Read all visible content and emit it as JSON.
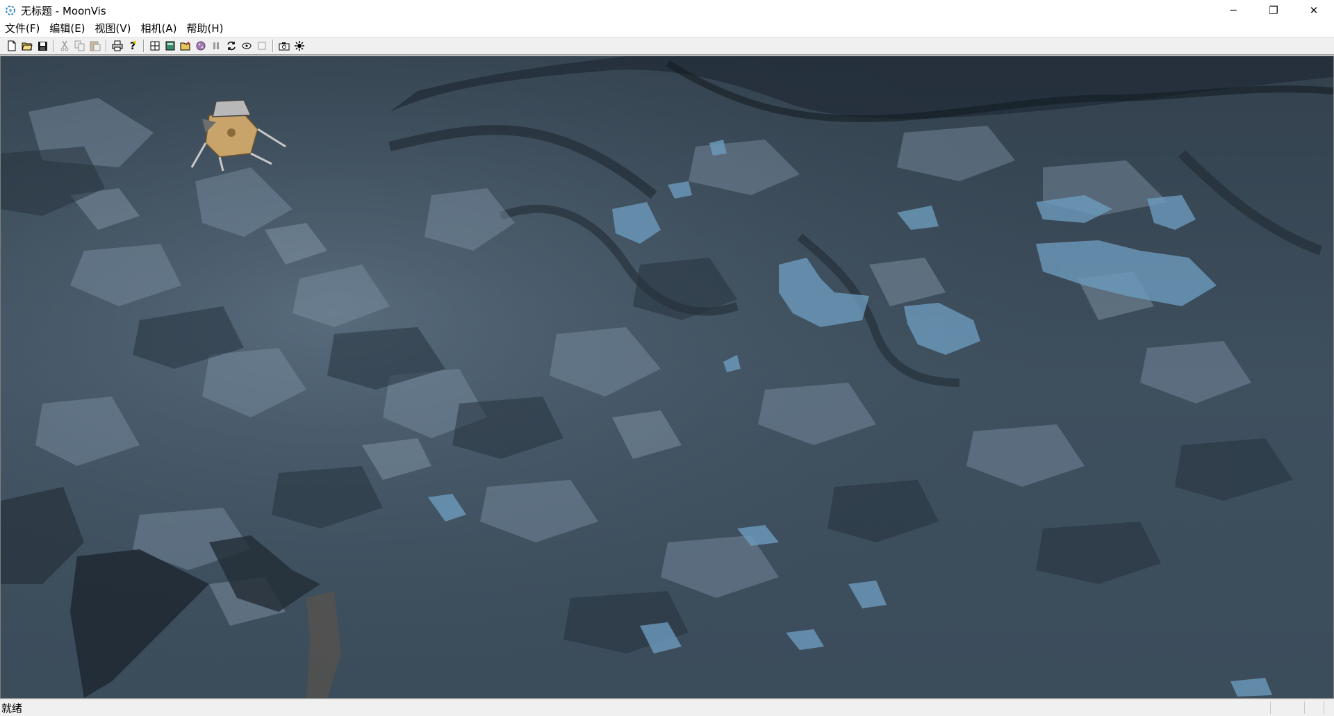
{
  "window": {
    "title": "无标题 - MoonVis",
    "app_icon": "moonvis-icon",
    "controls": {
      "minimize": "─",
      "restore": "❐",
      "close": "✕"
    }
  },
  "menu": {
    "items": [
      {
        "id": "file",
        "label": "文件(F)"
      },
      {
        "id": "edit",
        "label": "编辑(E)"
      },
      {
        "id": "view",
        "label": "视图(V)"
      },
      {
        "id": "camera",
        "label": "相机(A)"
      },
      {
        "id": "help",
        "label": "帮助(H)"
      }
    ]
  },
  "toolbar": {
    "buttons": [
      "new-icon",
      "open-icon",
      "save-icon",
      "cut-icon",
      "copy-icon",
      "paste-icon",
      "print-icon",
      "help-icon",
      "grid-icon",
      "panel-icon",
      "folder-load-icon",
      "texture-icon",
      "pause-icon",
      "refresh-icon",
      "orbit-icon",
      "frame-icon",
      "camera-icon",
      "sun-icon"
    ]
  },
  "viewport": {
    "scene": "lunar-surface",
    "object": "lunar-lander",
    "colors": {
      "surface": "#3a4a58",
      "shadow": "#1f2a34",
      "highlight": "#7f95a8",
      "ice": "#6d9bbd",
      "lander_gold": "#c9a46a"
    }
  },
  "status": {
    "text": "就绪"
  }
}
